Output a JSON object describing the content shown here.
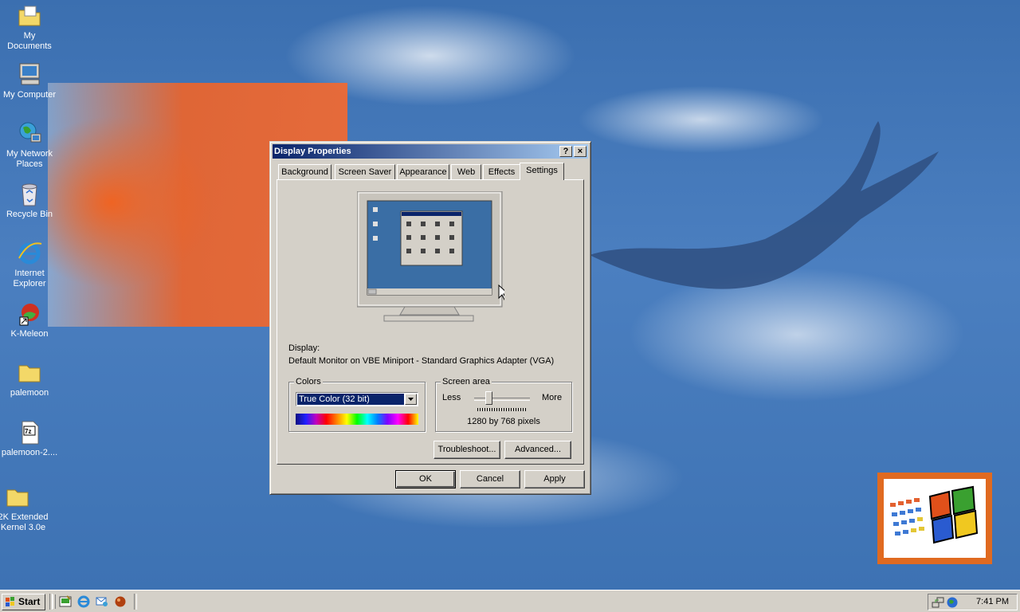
{
  "desktop": {
    "icons": [
      {
        "label": "My Documents"
      },
      {
        "label": "My Computer"
      },
      {
        "label": "My Network Places"
      },
      {
        "label": "Recycle Bin"
      },
      {
        "label": "Internet Explorer"
      },
      {
        "label": "K-Meleon"
      },
      {
        "label": "palemoon"
      },
      {
        "label": "palemoon-2...."
      },
      {
        "label": "2K Extended Kernel 3.0e"
      }
    ]
  },
  "dialog": {
    "title": "Display Properties",
    "help_btn": "?",
    "close_btn": "×",
    "tabs": [
      "Background",
      "Screen Saver",
      "Appearance",
      "Web",
      "Effects",
      "Settings"
    ],
    "active_tab": "Settings",
    "display_label": "Display:",
    "display_value": "Default Monitor on VBE Miniport - Standard Graphics Adapter (VGA)",
    "colors": {
      "group_title": "Colors",
      "selected": "True Color (32 bit)"
    },
    "screen_area": {
      "group_title": "Screen area",
      "less": "Less",
      "more": "More",
      "resolution_text": "1280 by 768 pixels",
      "slider_position": 0.25
    },
    "buttons": {
      "troubleshoot": "Troubleshoot...",
      "advanced": "Advanced...",
      "ok": "OK",
      "cancel": "Cancel",
      "apply": "Apply"
    }
  },
  "taskbar": {
    "start_label": "Start",
    "clock": "7:41 PM"
  },
  "colors": {
    "desktop_blue": "#3a6ea5",
    "title_active": "#0a246a",
    "face": "#d4d0c8",
    "select_blue": "#0a246a"
  }
}
